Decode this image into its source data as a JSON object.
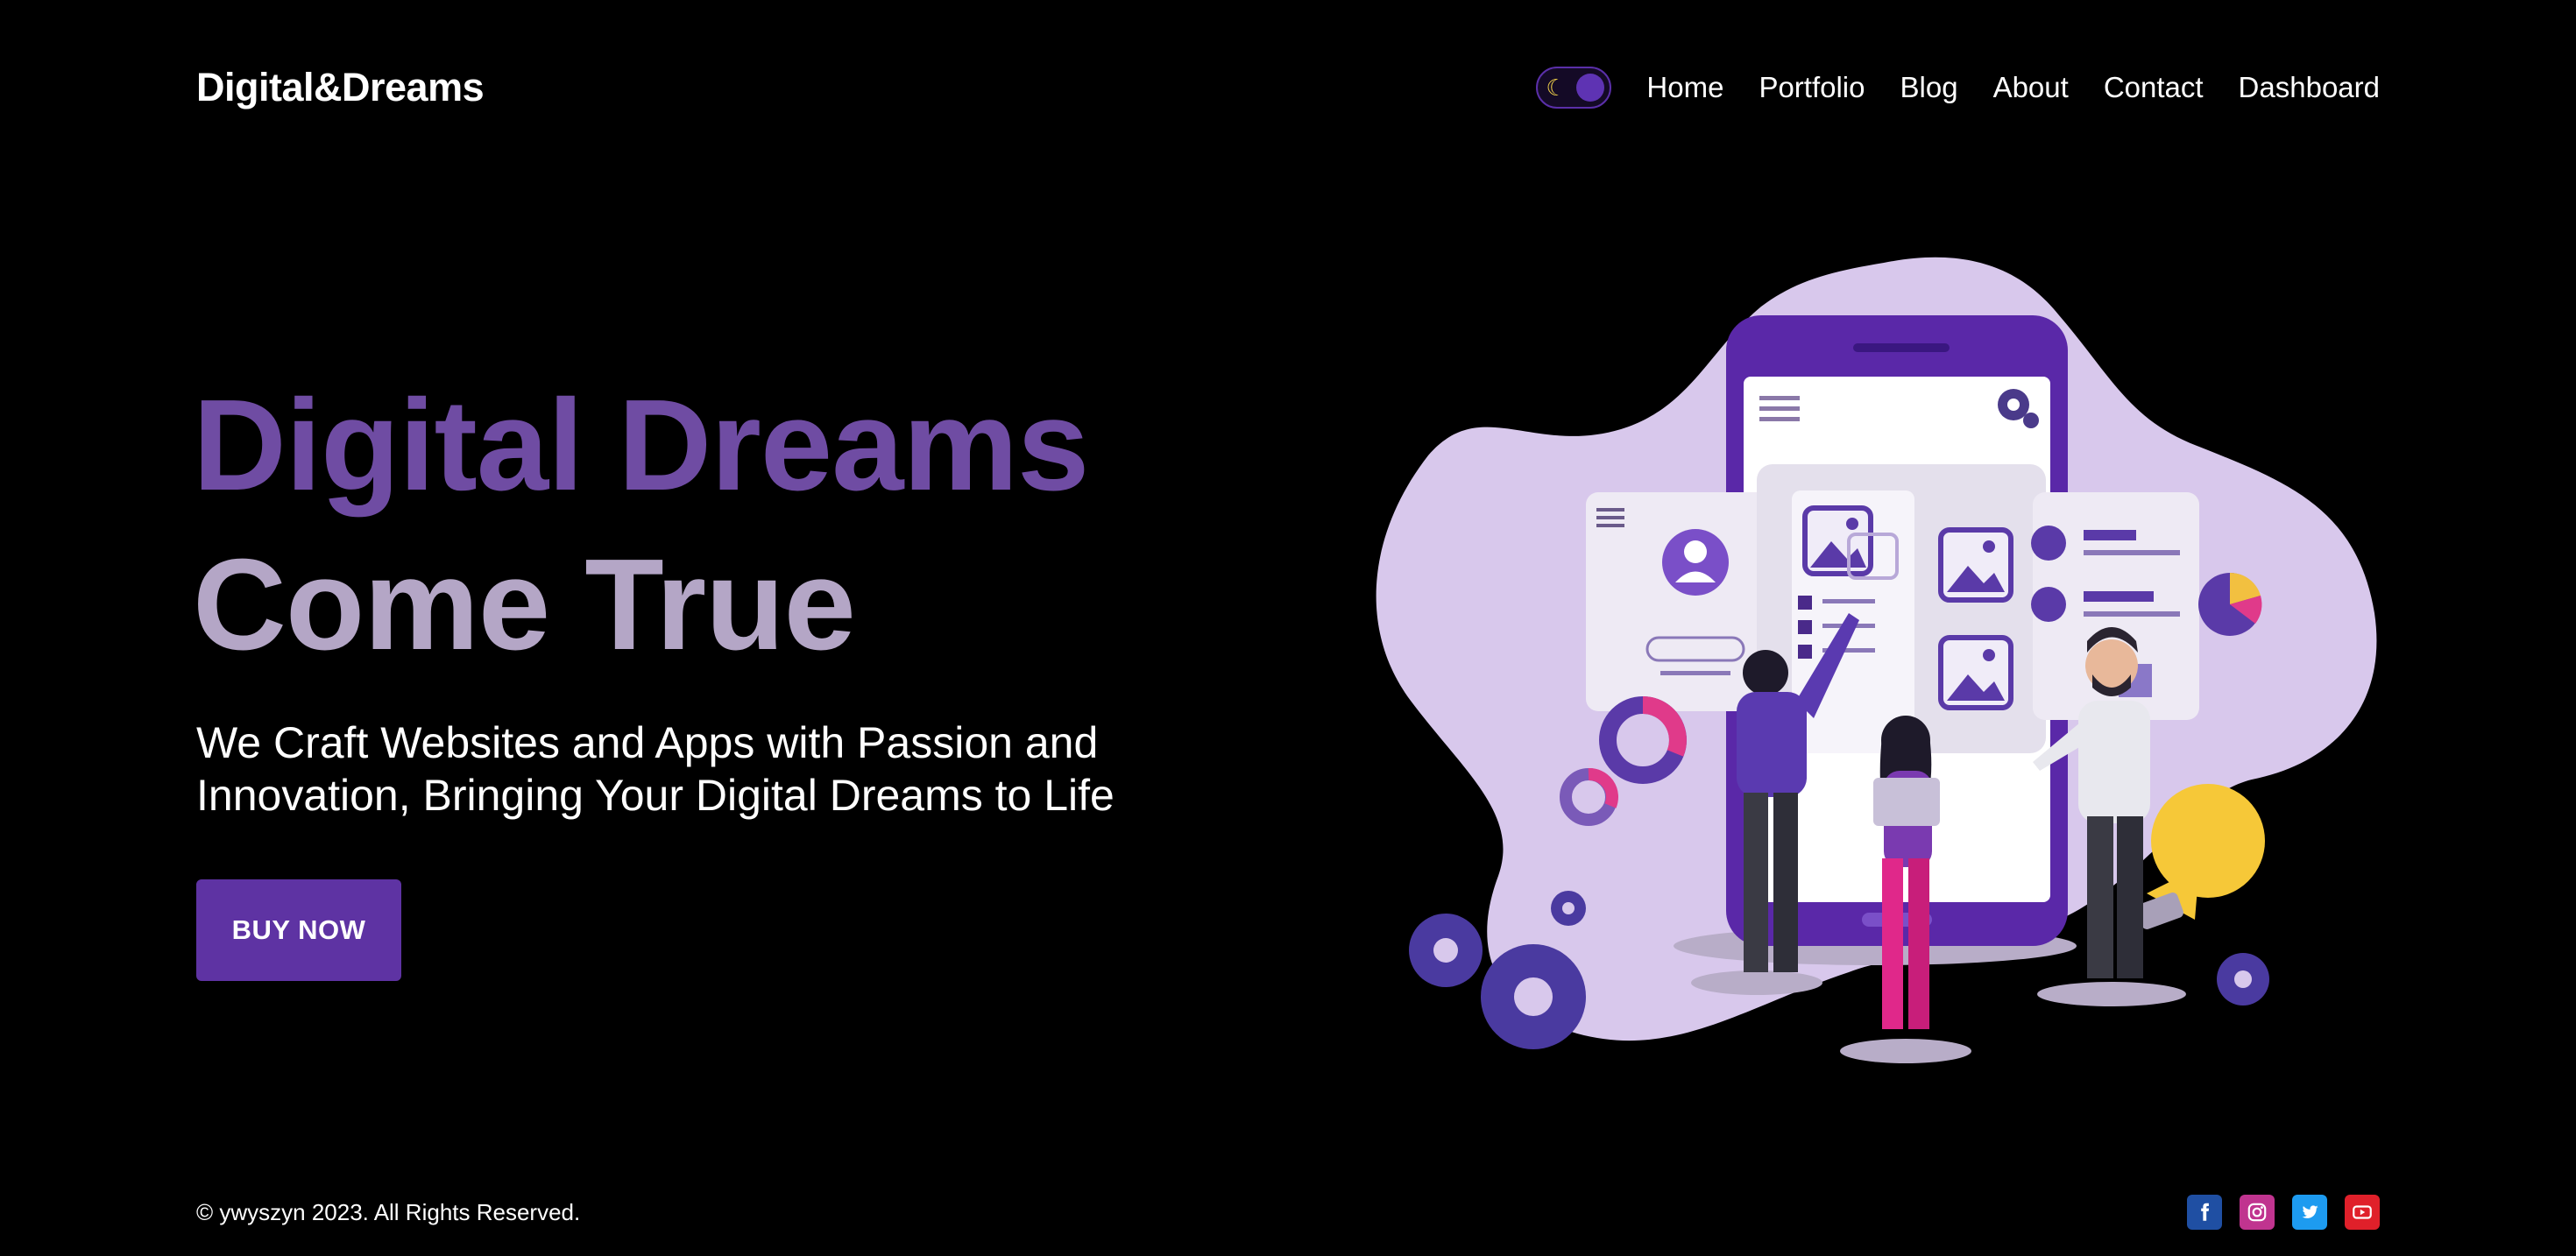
{
  "header": {
    "logo": "Digital&Dreams",
    "theme_toggle_icon": "moon-icon",
    "nav": [
      {
        "label": "Home"
      },
      {
        "label": "Portfolio"
      },
      {
        "label": "Blog"
      },
      {
        "label": "About"
      },
      {
        "label": "Contact"
      },
      {
        "label": "Dashboard"
      }
    ]
  },
  "hero": {
    "title_line1": "Digital Dreams",
    "title_line2": "Come True",
    "subtitle_line1": "We Craft Websites and Apps with Passion and",
    "subtitle_line2": "Innovation, Bringing Your Digital Dreams to Life",
    "button_label": "BUY NOW",
    "illustration_icon": "app-team-illustration"
  },
  "footer": {
    "copyright": "© ywyszyn 2023. All Rights Reserved.",
    "socials": [
      {
        "icon": "facebook-icon",
        "color": "#1f4fa3"
      },
      {
        "icon": "instagram-icon",
        "color": "#c0348f"
      },
      {
        "icon": "twitter-icon",
        "color": "#1d9bf0"
      },
      {
        "icon": "youtube-icon",
        "color": "#e0202a"
      }
    ]
  },
  "colors": {
    "background": "#000000",
    "accent": "#5e33a3",
    "title_primary": "#6f4ca3",
    "title_secondary": "#b4a6c6"
  }
}
